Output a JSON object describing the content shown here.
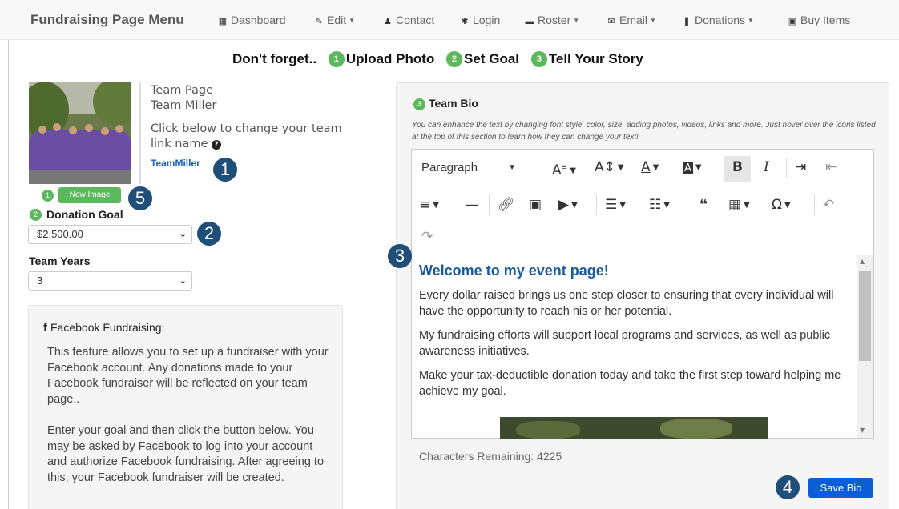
{
  "nav": {
    "brand": "Fundraising Page Menu",
    "items": [
      {
        "label": "Dashboard",
        "icon": "dashboard-icon",
        "dropdown": false
      },
      {
        "label": "Edit",
        "icon": "pencil-icon",
        "dropdown": true
      },
      {
        "label": "Contact",
        "icon": "user-icon",
        "dropdown": false
      },
      {
        "label": "Login",
        "icon": "asterisk-icon",
        "dropdown": false
      },
      {
        "label": "Roster",
        "icon": "briefcase-icon",
        "dropdown": true
      },
      {
        "label": "Email",
        "icon": "envelope-icon",
        "dropdown": true
      },
      {
        "label": "Donations",
        "icon": "gift-icon",
        "dropdown": true
      },
      {
        "label": "Buy Items",
        "icon": "money-icon",
        "dropdown": false
      }
    ]
  },
  "reminder": {
    "prefix": "Don't forget..",
    "steps": [
      {
        "num": "1",
        "label": "Upload Photo"
      },
      {
        "num": "2",
        "label": "Set Goal"
      },
      {
        "num": "3",
        "label": "Tell Your Story"
      }
    ]
  },
  "team": {
    "page_label": "Team Page",
    "name": "Team Miller",
    "change_text": "Click below to change your team link name",
    "link_name": "TeamMiller",
    "new_image_num": "1",
    "new_image_label": "New Image"
  },
  "goal": {
    "num": "2",
    "label": "Donation Goal",
    "value": "$2,500.00"
  },
  "years": {
    "label": "Team Years",
    "value": "3"
  },
  "facebook": {
    "icon_glyph": "f",
    "title": "Facebook Fundraising:",
    "p1": "This feature allows you to set up a fundraiser with your Facebook account. Any donations made to your Facebook fundraiser will be reflected on your team page..",
    "p2": "Enter your goal and then click the button below. You may be asked by Facebook to log into your account and authorize Facebook fundraising. After agreeing to this, your Facebook fundraiser will be created."
  },
  "bio": {
    "num": "3",
    "title": "Team Bio",
    "hint": "You can enhance the text by changing font style, color, size, adding photos, videos, links and more. Just hover over the icons listed at the top of this section to learn how they can change your text!",
    "paragraph_style": "Paragraph",
    "heading": "Welcome to my event page!",
    "paragraphs": [
      "Every dollar raised brings us one step closer to ensuring that every individual will have the opportunity to reach his or her potential.",
      "My fundraising efforts will support local programs and services, as well as public awareness initiatives.",
      "Make your tax-deductible donation today and take the first step toward helping me achieve my goal."
    ],
    "chars_remaining": "Characters Remaining: 4225",
    "save_label": "Save Bio"
  },
  "callouts": [
    "1",
    "2",
    "3",
    "4",
    "5"
  ],
  "colors": {
    "accent_green": "#5cb85c",
    "callout_navy": "#1f4e79",
    "save_blue": "#0b5ed7",
    "link_blue": "#1a62b5"
  }
}
